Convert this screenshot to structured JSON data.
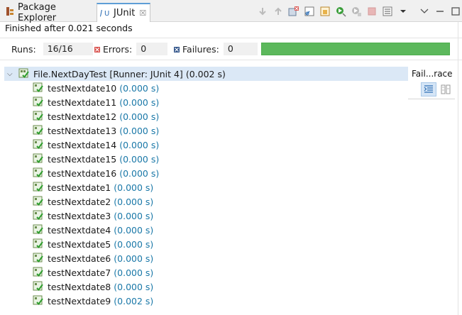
{
  "tabs": {
    "package_explorer": "Package Explorer",
    "junit": "JUnit",
    "close_glyph": "☒"
  },
  "icons": [
    "next-failure-icon",
    "previous-failure-icon",
    "show-failures-only-icon",
    "scroll-lock-icon",
    "layout-icon",
    "rerun-icon",
    "rerun-failed-icon",
    "stop-icon",
    "history-icon",
    "dropdown-icon",
    "view-menu-icon",
    "minimize-icon",
    "maximize-icon"
  ],
  "status": "Finished after 0.021 seconds",
  "counters": {
    "runs_label": "Runs:",
    "runs_value": "16/16",
    "errors_label": "Errors:",
    "errors_value": "0",
    "failures_label": "Failures:",
    "failures_value": "0",
    "progress_fraction": 1.0,
    "progress_color": "#5cb85c"
  },
  "suite": {
    "name": "File.NextDayTest",
    "runner": "[Runner: JUnit 4]",
    "time": "(0.002 s)"
  },
  "tests": [
    {
      "name": "testNextdate10",
      "time": "(0.000 s)"
    },
    {
      "name": "testNextdate11",
      "time": "(0.000 s)"
    },
    {
      "name": "testNextdate12",
      "time": "(0.000 s)"
    },
    {
      "name": "testNextdate13",
      "time": "(0.000 s)"
    },
    {
      "name": "testNextdate14",
      "time": "(0.000 s)"
    },
    {
      "name": "testNextdate15",
      "time": "(0.000 s)"
    },
    {
      "name": "testNextdate16",
      "time": "(0.000 s)"
    },
    {
      "name": "testNextdate1",
      "time": "(0.000 s)"
    },
    {
      "name": "testNextdate2",
      "time": "(0.000 s)"
    },
    {
      "name": "testNextdate3",
      "time": "(0.000 s)"
    },
    {
      "name": "testNextdate4",
      "time": "(0.000 s)"
    },
    {
      "name": "testNextdate5",
      "time": "(0.000 s)"
    },
    {
      "name": "testNextdate6",
      "time": "(0.000 s)"
    },
    {
      "name": "testNextdate7",
      "time": "(0.000 s)"
    },
    {
      "name": "testNextdate8",
      "time": "(0.000 s)"
    },
    {
      "name": "testNextdate9",
      "time": "(0.002 s)"
    }
  ],
  "failure_trace": {
    "title": "Fail...race"
  }
}
